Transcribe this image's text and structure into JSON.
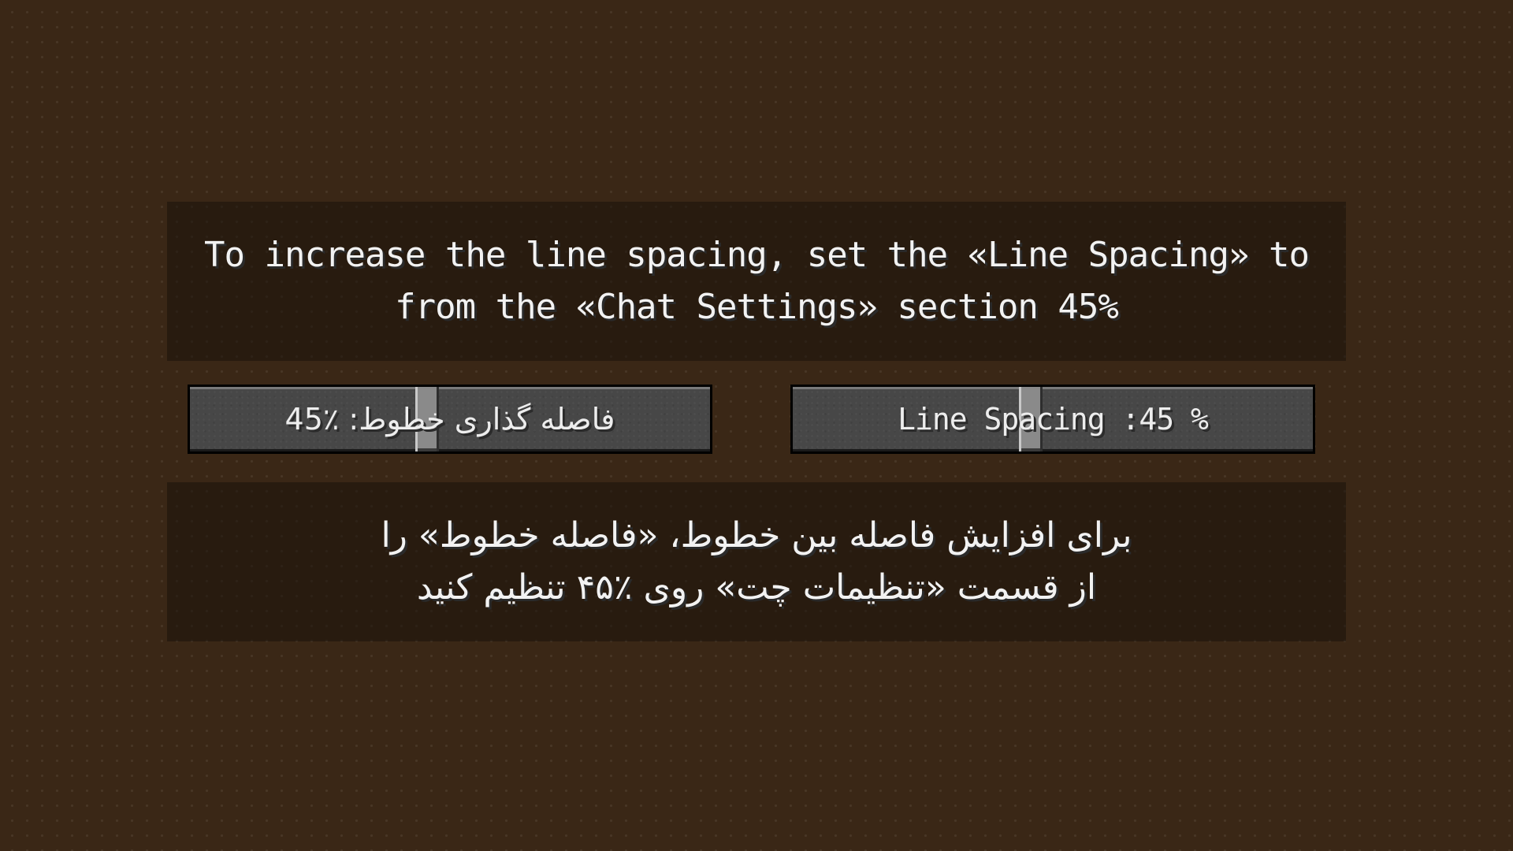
{
  "instructions_en": {
    "line1": "To increase the line spacing, set the «Line Spacing» to",
    "line2": "from the «Chat Settings» section 45%"
  },
  "sliders": {
    "fa": {
      "label": "فاصله گذاری خطوط: ٪45",
      "value_percent": 45
    },
    "en": {
      "label": "Line Spacing :45 %",
      "value_percent": 45
    }
  },
  "instructions_fa": {
    "line1": "برای افزایش فاصله بین خطوط، «فاصله خطوط» را",
    "line2": "از قسمت «تنظیمات چت» روی ٪۴۵ تنظیم کنید"
  },
  "colors": {
    "background": "#3a2716",
    "panel": "#1a120b",
    "slider_track": "#474747",
    "slider_handle": "#8a8a8a",
    "text": "#f2f2f2"
  }
}
